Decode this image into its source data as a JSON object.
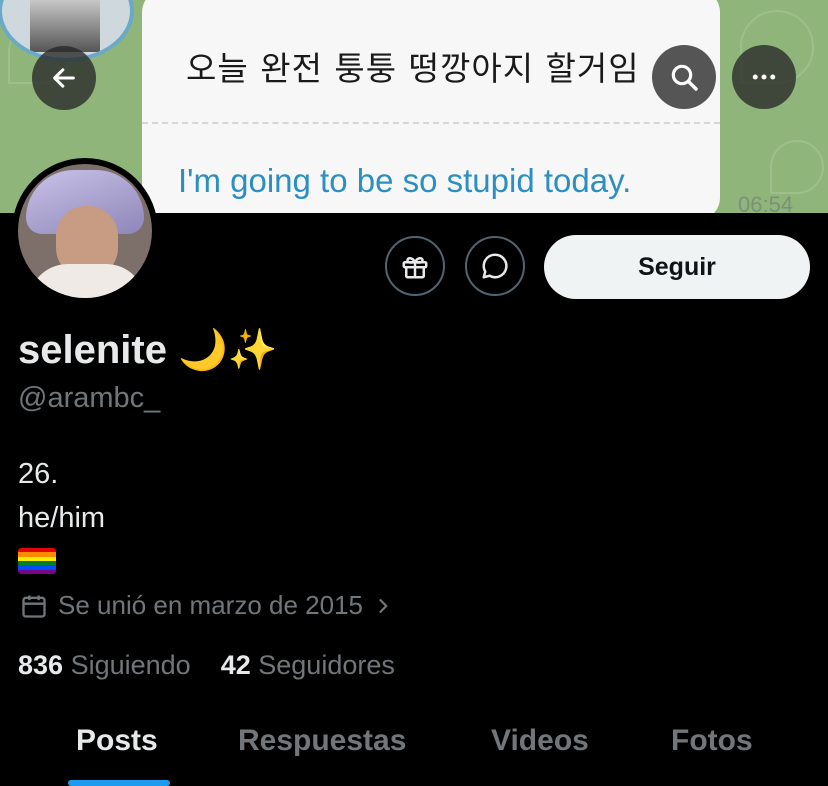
{
  "banner": {
    "korean_text": "오늘 완전 퉁퉁 떵깡아지 할거임",
    "english_text": "I'm going to be so stupid today.",
    "time": "06:54"
  },
  "profile": {
    "display_name": "selenite 🌙✨",
    "handle": "@arambc_",
    "bio_lines": [
      "26.",
      "he/him"
    ],
    "joined": "Se unió en marzo de 2015",
    "following_count": "836",
    "following_label": "Siguiendo",
    "followers_count": "42",
    "followers_label": "Seguidores"
  },
  "actions": {
    "follow_label": "Seguir"
  },
  "tabs": [
    {
      "label": "Posts",
      "active": true
    },
    {
      "label": "Respuestas",
      "active": false
    },
    {
      "label": "Videos",
      "active": false
    },
    {
      "label": "Fotos",
      "active": false
    }
  ],
  "colors": {
    "accent": "#1d9bf0",
    "background": "#000000",
    "banner": "#8fb57a",
    "muted": "#71767b"
  },
  "icons": [
    "back-arrow-icon",
    "search-icon",
    "more-icon",
    "gift-icon",
    "message-icon",
    "calendar-icon",
    "chevron-right-icon"
  ]
}
